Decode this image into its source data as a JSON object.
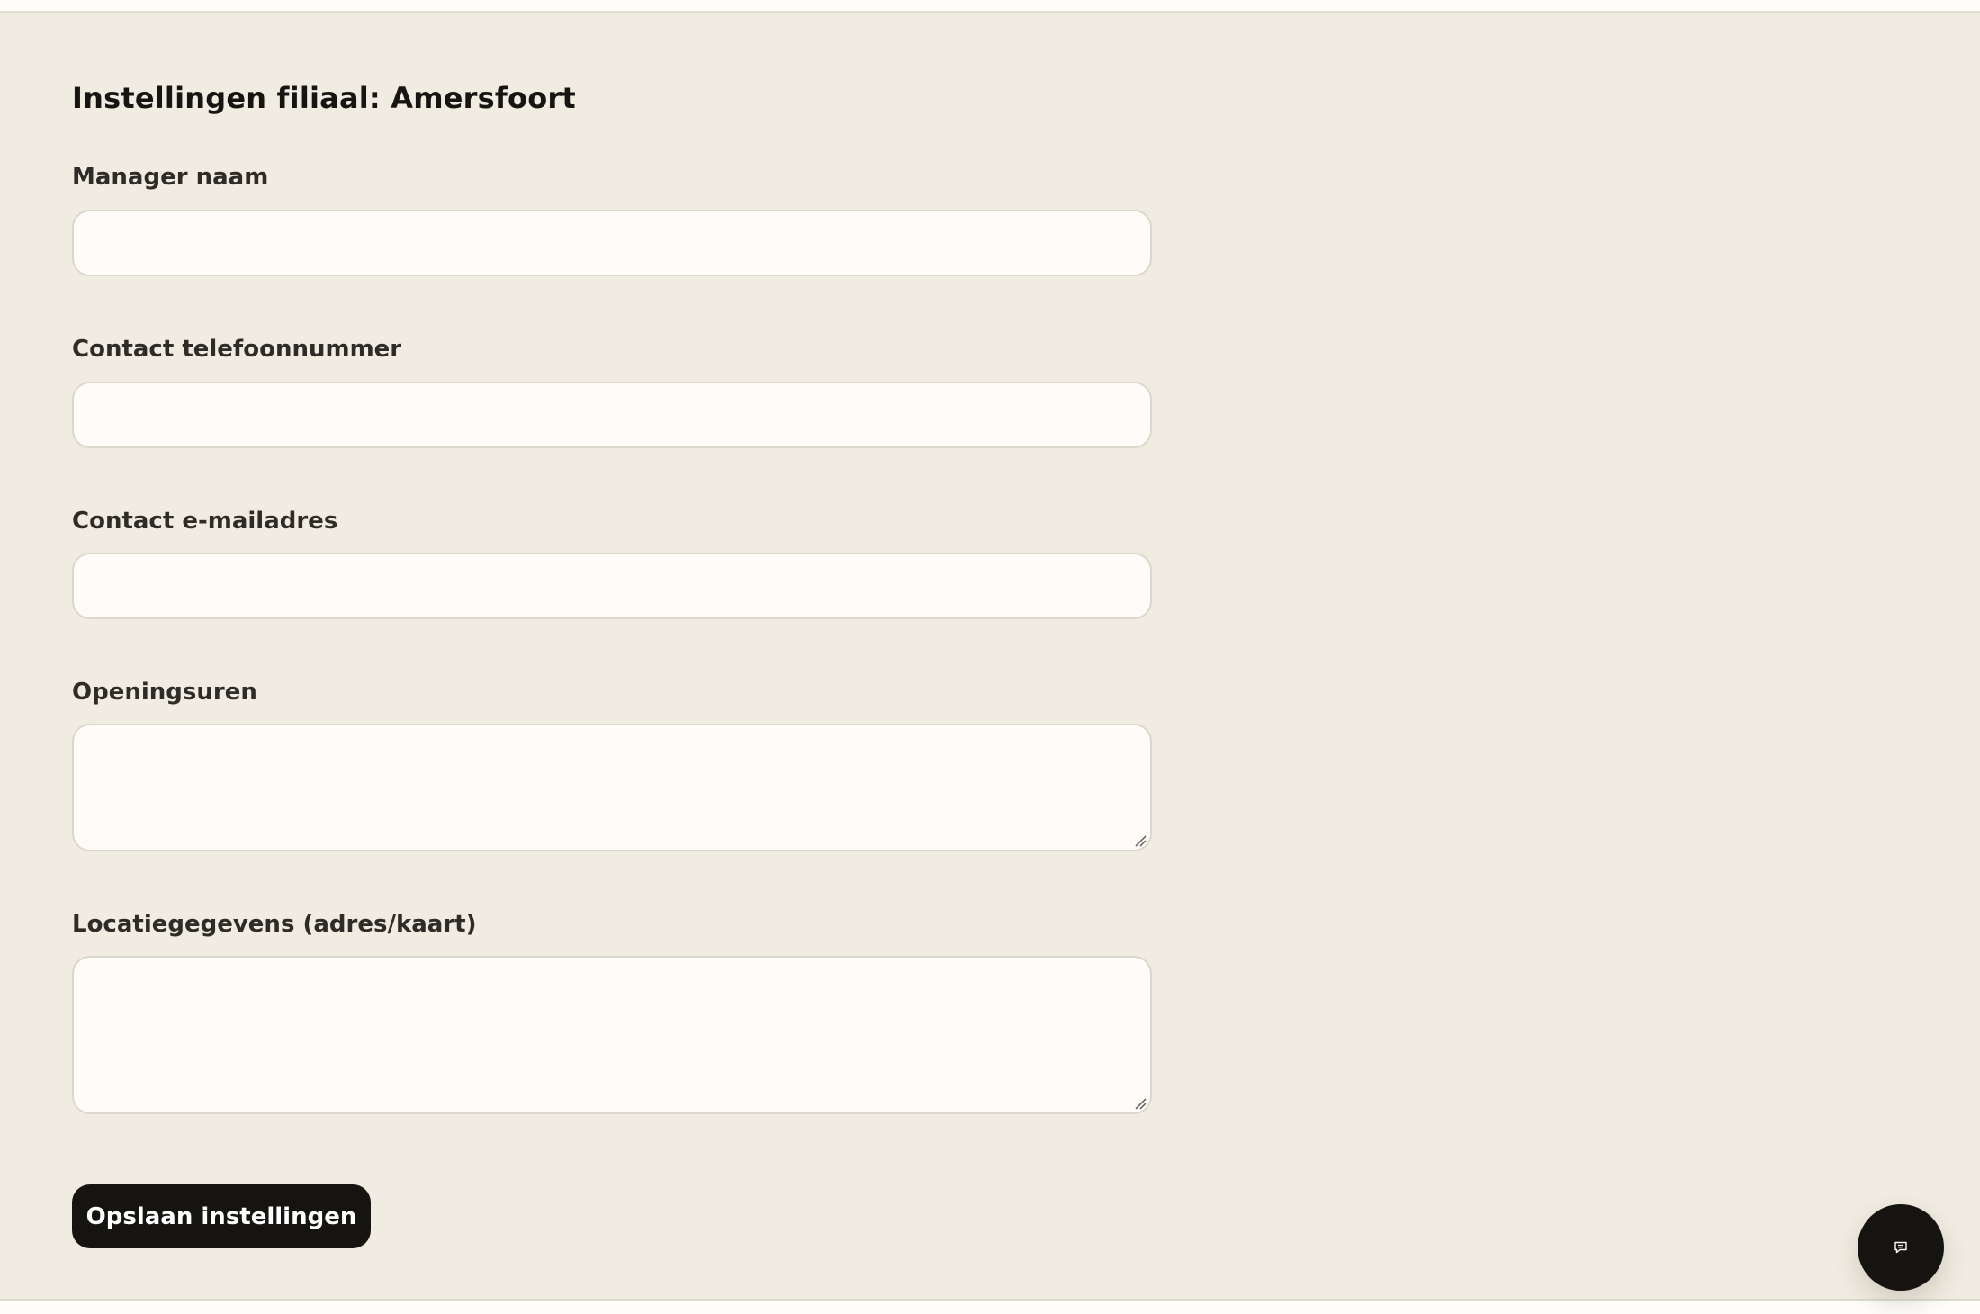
{
  "page": {
    "title": "Instellingen filiaal: Amersfoort"
  },
  "form": {
    "fields": [
      {
        "label": "Manager naam",
        "value": "",
        "type": "input"
      },
      {
        "label": "Contact telefoonnummer",
        "value": "",
        "type": "input"
      },
      {
        "label": "Contact e-mailadres",
        "value": "",
        "type": "input"
      },
      {
        "label": "Openingsuren",
        "value": "",
        "type": "textarea"
      },
      {
        "label": "Locatiegegevens (adres/kaart)",
        "value": "",
        "type": "textarea"
      }
    ],
    "save_label": "Opslaan instellingen"
  },
  "chat": {
    "icon": "chat-bubble-icon"
  },
  "colors": {
    "panel_background": "#f1ece2",
    "field_background": "#fdfcf8",
    "field_border": "#dcd7cc",
    "button_background": "#161410",
    "button_text": "#ffffff"
  }
}
